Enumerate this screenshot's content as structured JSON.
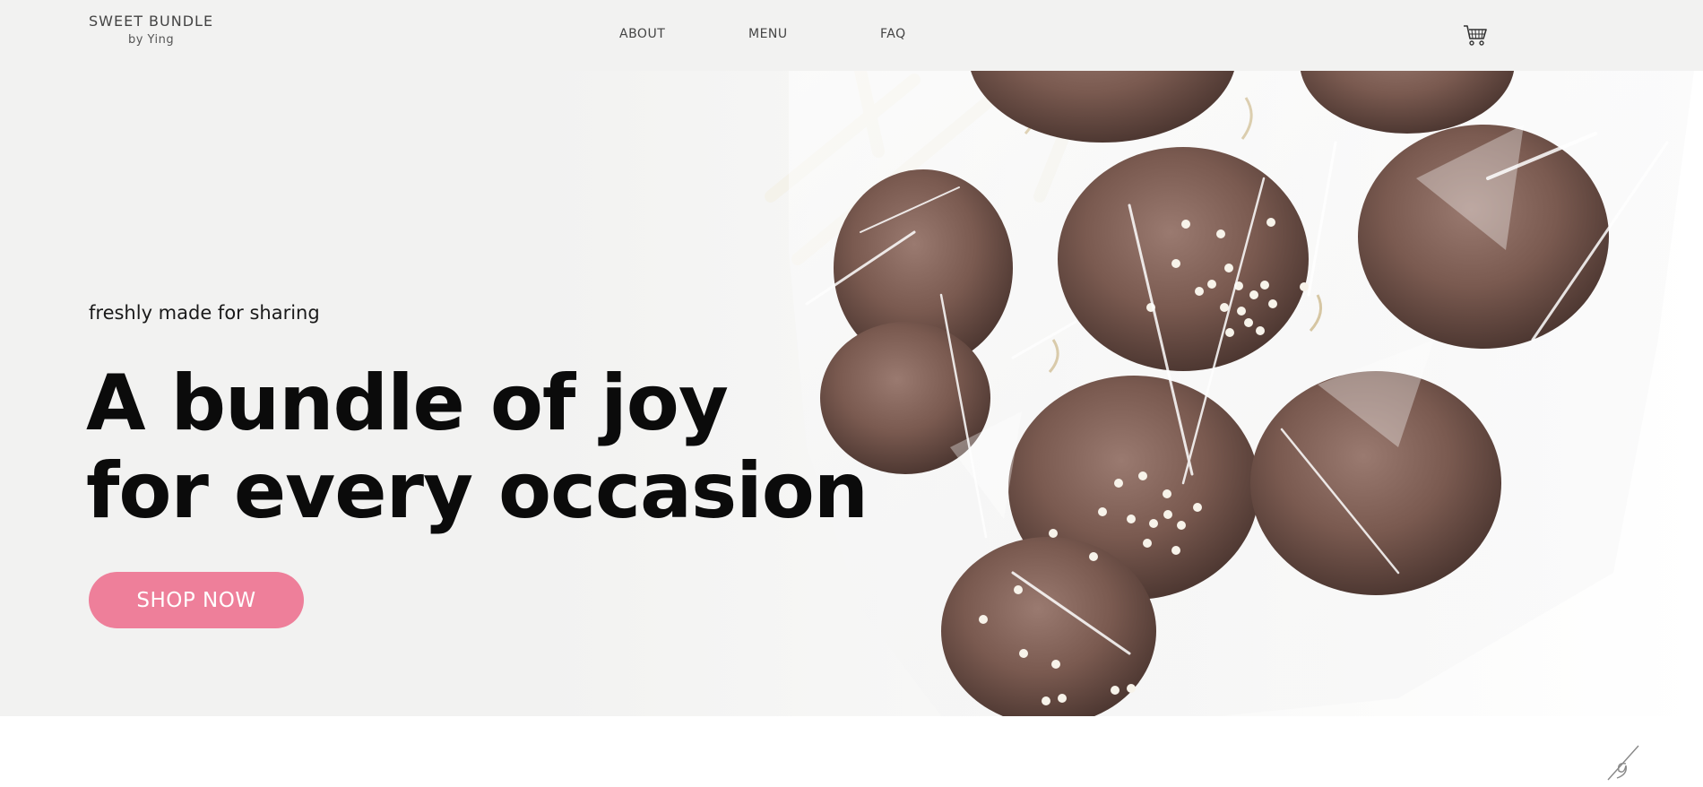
{
  "brand": {
    "title": "SWEET BUNDLE",
    "subtitle": "by Ying"
  },
  "nav": {
    "items": [
      {
        "label": "ABOUT"
      },
      {
        "label": "MENU"
      },
      {
        "label": "FAQ"
      }
    ]
  },
  "icons": {
    "cart": "cart-icon"
  },
  "hero": {
    "tagline": "freshly made for sharing",
    "headline_line1": "A bundle of joy",
    "headline_line2": "for every occasion",
    "cta_label": "SHOP NOW",
    "image_description": "cellophane-wrapped chocolate cake pops with white sprinkles"
  },
  "colors": {
    "accent": "#ee7f9a",
    "background": "#f2f2f1",
    "chocolate": "#7a5a50"
  }
}
